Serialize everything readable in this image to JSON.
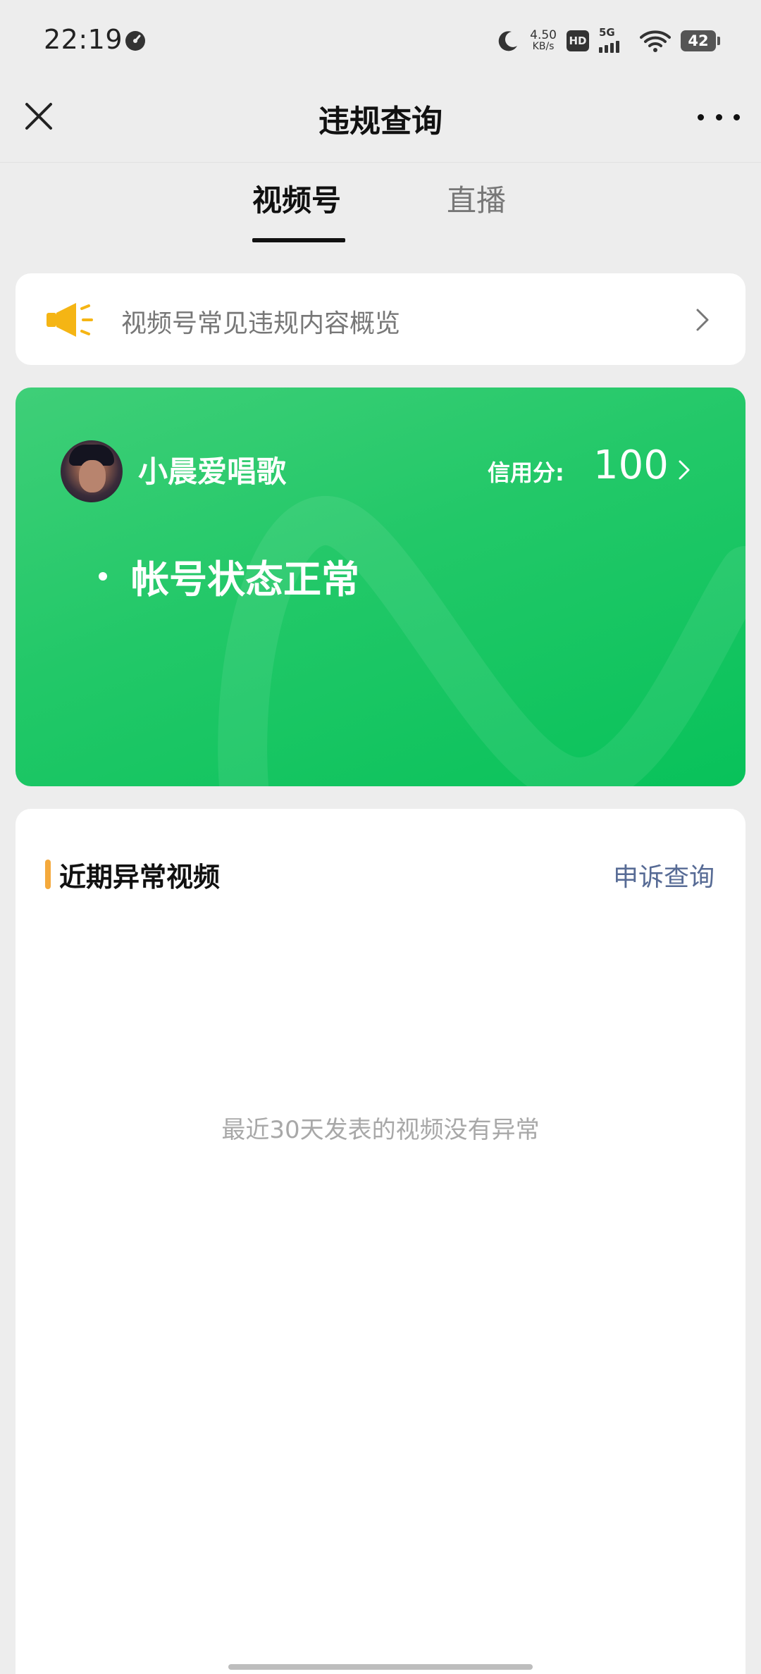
{
  "status_bar": {
    "time": "22:19",
    "net_speed": "4.50",
    "net_speed_unit": "KB/s",
    "hd_label": "HD",
    "signal_label": "5G",
    "battery": "42"
  },
  "nav": {
    "title": "违规查询"
  },
  "tabs": [
    {
      "label": "视频号",
      "active": true
    },
    {
      "label": "直播",
      "active": false
    }
  ],
  "notice": {
    "text": "视频号常见违规内容概览"
  },
  "account_card": {
    "username": "小晨爱唱歌",
    "credit_label": "信用分:",
    "credit_value": "100",
    "status_text": "帐号状态正常",
    "accent_color": "#07c160"
  },
  "recent": {
    "title": "近期异常视频",
    "appeal_link": "申诉查询",
    "empty_text": "最近30天发表的视频没有异常",
    "bar_color": "#f4a93c"
  }
}
